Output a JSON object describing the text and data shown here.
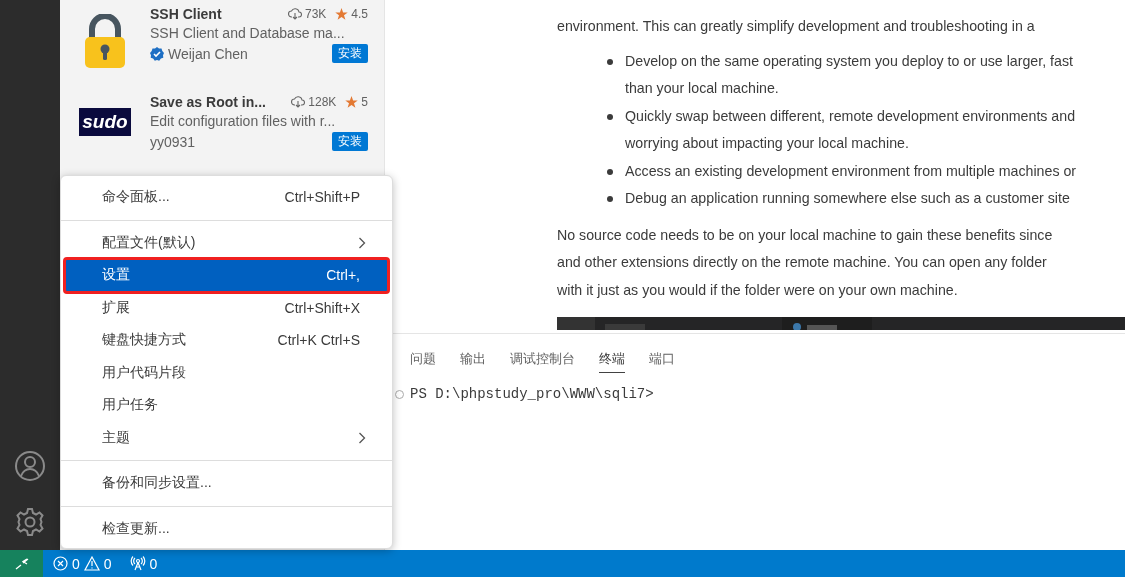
{
  "extensions": [
    {
      "name": "SSH Client",
      "downloads": "73K",
      "rating": "4.5",
      "description": "SSH Client and Database ma...",
      "publisher": "Weijan Chen",
      "verified": true,
      "install": "安装",
      "kind": "lock"
    },
    {
      "name": "Save as Root in...",
      "downloads": "128K",
      "rating": "5",
      "description": "Edit configuration files with r...",
      "publisher": "yy0931",
      "verified": false,
      "install": "安装",
      "kind": "sudo",
      "logo_text": "sudo"
    }
  ],
  "document": {
    "intro": "environment. This can greatly simplify development and troubleshooting in a",
    "bullets": [
      {
        "lines": [
          "Develop on the same operating system you deploy to or use larger, fast",
          "than your local machine."
        ]
      },
      {
        "lines": [
          "Quickly swap between different, remote development environments and",
          "worrying about impacting your local machine."
        ]
      },
      {
        "lines": [
          "Access an existing development environment from multiple machines or"
        ]
      },
      {
        "lines": [
          "Debug an application running somewhere else such as a customer site"
        ]
      }
    ],
    "paragraph": [
      "No source code needs to be on your local machine to gain these benefits since",
      "and other extensions directly on the remote machine. You can open any folder",
      "with it just as you would if the folder were on your own machine."
    ],
    "image": {
      "kind": "picture"
    }
  },
  "panel": {
    "tabs": [
      {
        "label": "问题",
        "selected": false
      },
      {
        "label": "输出",
        "selected": false
      },
      {
        "label": "调试控制台",
        "selected": false
      },
      {
        "label": "终端",
        "selected": true
      },
      {
        "label": "端口",
        "selected": false
      }
    ],
    "terminal_line": "PS D:\\phpstudy_pro\\WWW\\sqli7>"
  },
  "menu": {
    "groups": [
      [
        {
          "label": "命令面板...",
          "shortcut": "Ctrl+Shift+P",
          "submenu": false,
          "selected": false
        }
      ],
      [
        {
          "label": "配置文件(默认)",
          "submenu": true,
          "selected": false
        },
        {
          "label": "设置",
          "shortcut": "Ctrl+,",
          "submenu": false,
          "selected": true
        },
        {
          "label": "扩展",
          "shortcut": "Ctrl+Shift+X",
          "submenu": false,
          "selected": false
        },
        {
          "label": "键盘快捷方式",
          "shortcut": "Ctrl+K Ctrl+S",
          "submenu": false,
          "selected": false
        },
        {
          "label": "用户代码片段",
          "submenu": false,
          "selected": false
        },
        {
          "label": "用户任务",
          "submenu": false,
          "selected": false
        },
        {
          "label": "主题",
          "submenu": true,
          "selected": false
        }
      ],
      [
        {
          "label": "备份和同步设置...",
          "submenu": false,
          "selected": false
        }
      ],
      [
        {
          "label": "检查更新...",
          "submenu": false,
          "selected": false
        }
      ]
    ]
  },
  "status_bar": {
    "errors": "0",
    "warnings": "0",
    "ports": "0"
  }
}
